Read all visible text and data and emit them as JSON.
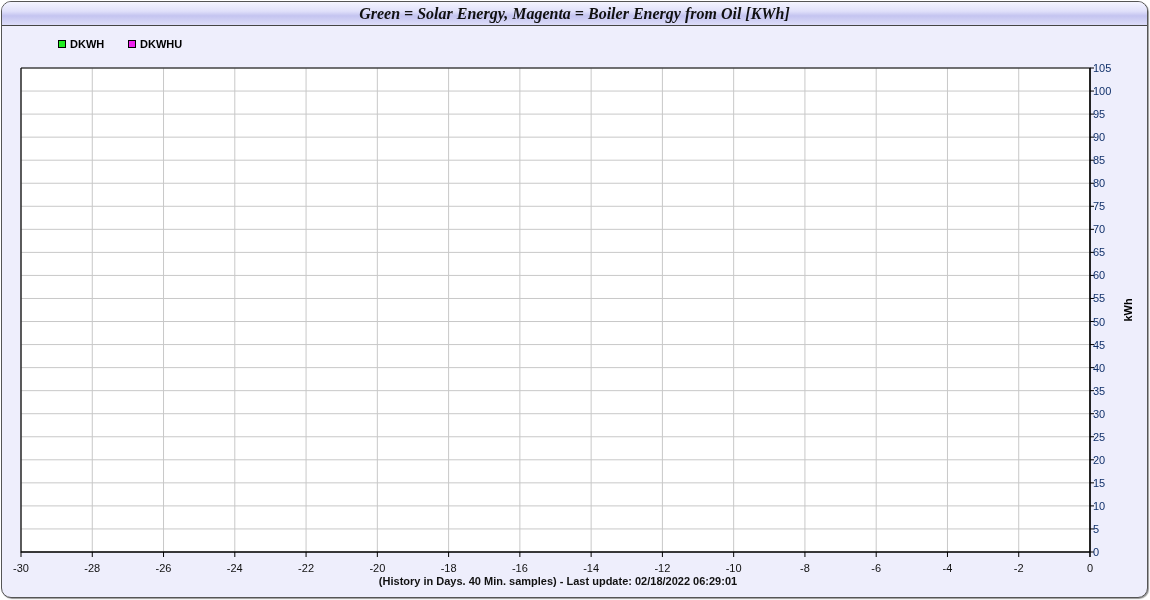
{
  "window": {
    "title": "Green = Solar Energy, Magenta = Boiler Energy from Oil [KWh]"
  },
  "chart": {
    "chart_data": {
      "type": "line",
      "xlabel": "(History in Days. 40 Min. samples) - Last update: 02/18/2022 06:29:01",
      "ylabel": "kWh",
      "series": [
        {
          "name": "DKWH",
          "color": "#22ee22",
          "values": [
            null,
            null,
            null,
            null,
            null,
            null,
            null,
            null,
            null,
            null,
            null,
            null,
            null,
            null,
            null,
            null
          ]
        },
        {
          "name": "DKWHU",
          "color": "#ee22ee",
          "values": [
            null,
            null,
            null,
            null,
            null,
            null,
            null,
            null,
            null,
            null,
            null,
            null,
            null,
            null,
            null,
            null
          ]
        }
      ],
      "categories": [
        "-30",
        "-28",
        "-26",
        "-24",
        "-22",
        "-20",
        "-18",
        "-16",
        "-14",
        "-12",
        "-10",
        "-8",
        "-6",
        "-4",
        "-2",
        "0"
      ],
      "grid": true,
      "ylim": [
        0,
        105
      ],
      "yticks": [
        0,
        5,
        10,
        15,
        20,
        25,
        30,
        35,
        40,
        45,
        50,
        55,
        60,
        65,
        70,
        75,
        80,
        85,
        90,
        95,
        100,
        105
      ]
    }
  }
}
